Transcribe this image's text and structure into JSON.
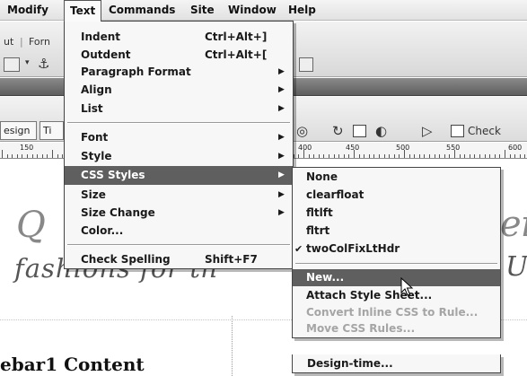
{
  "menubar": {
    "items": [
      "Modify",
      "Text",
      "Commands",
      "Site",
      "Window",
      "Help"
    ],
    "open_menu": "Text"
  },
  "insert_toolbar": {
    "tab_fragments": [
      "ut",
      "Forn"
    ]
  },
  "document_toolbar": {
    "view_buttons": [
      "esign",
      "Ti"
    ],
    "check_label": "Check"
  },
  "ruler": {
    "labels": [
      "150",
      "400",
      "450",
      "500",
      "550",
      "600"
    ]
  },
  "text_menu": {
    "items": [
      {
        "label": "Indent",
        "shortcut": "Ctrl+Alt+]",
        "submenu": false
      },
      {
        "label": "Outdent",
        "shortcut": "Ctrl+Alt+[",
        "submenu": false
      },
      {
        "label": "Paragraph Format",
        "shortcut": "",
        "submenu": true
      },
      {
        "label": "Align",
        "shortcut": "",
        "submenu": true
      },
      {
        "label": "List",
        "shortcut": "",
        "submenu": true
      },
      {
        "label": "Font",
        "shortcut": "",
        "submenu": true
      },
      {
        "label": "Style",
        "shortcut": "",
        "submenu": true
      },
      {
        "label": "CSS Styles",
        "shortcut": "",
        "submenu": true,
        "highlighted": true
      },
      {
        "label": "Size",
        "shortcut": "",
        "submenu": true
      },
      {
        "label": "Size Change",
        "shortcut": "",
        "submenu": true
      },
      {
        "label": "Color...",
        "shortcut": "",
        "submenu": false
      },
      {
        "label": "Check Spelling",
        "shortcut": "Shift+F7",
        "submenu": false
      }
    ]
  },
  "css_styles_submenu": {
    "items": [
      {
        "label": "None",
        "checked": false,
        "disabled": false
      },
      {
        "label": "clearfloat",
        "checked": false,
        "disabled": false
      },
      {
        "label": "fltlft",
        "checked": false,
        "disabled": false
      },
      {
        "label": "fltrt",
        "checked": false,
        "disabled": false
      },
      {
        "label": "twoColFixLtHdr",
        "checked": true,
        "disabled": false
      },
      {
        "label": "New...",
        "checked": false,
        "disabled": false,
        "highlighted": true
      },
      {
        "label": "Attach Style Sheet...",
        "checked": false,
        "disabled": false
      },
      {
        "label": "Convert Inline CSS to Rule...",
        "checked": false,
        "disabled": true
      },
      {
        "label": "Move CSS Rules...",
        "checked": false,
        "disabled": true
      },
      {
        "label": "Design-time...",
        "checked": false,
        "disabled": false
      }
    ],
    "checkmark_glyph": "✔",
    "arrow_glyph": "▶"
  },
  "design_view": {
    "script_letter_left": "Q",
    "script_letter_right": "ei",
    "script_line": "fashions for th",
    "script_right_line": "Ur",
    "sidebar_heading": "ebar1 Content"
  },
  "colors": {
    "menu_background": "#f7f7f7",
    "highlight": "#5f5f5f",
    "disabled_text": "#a5a5a5"
  }
}
